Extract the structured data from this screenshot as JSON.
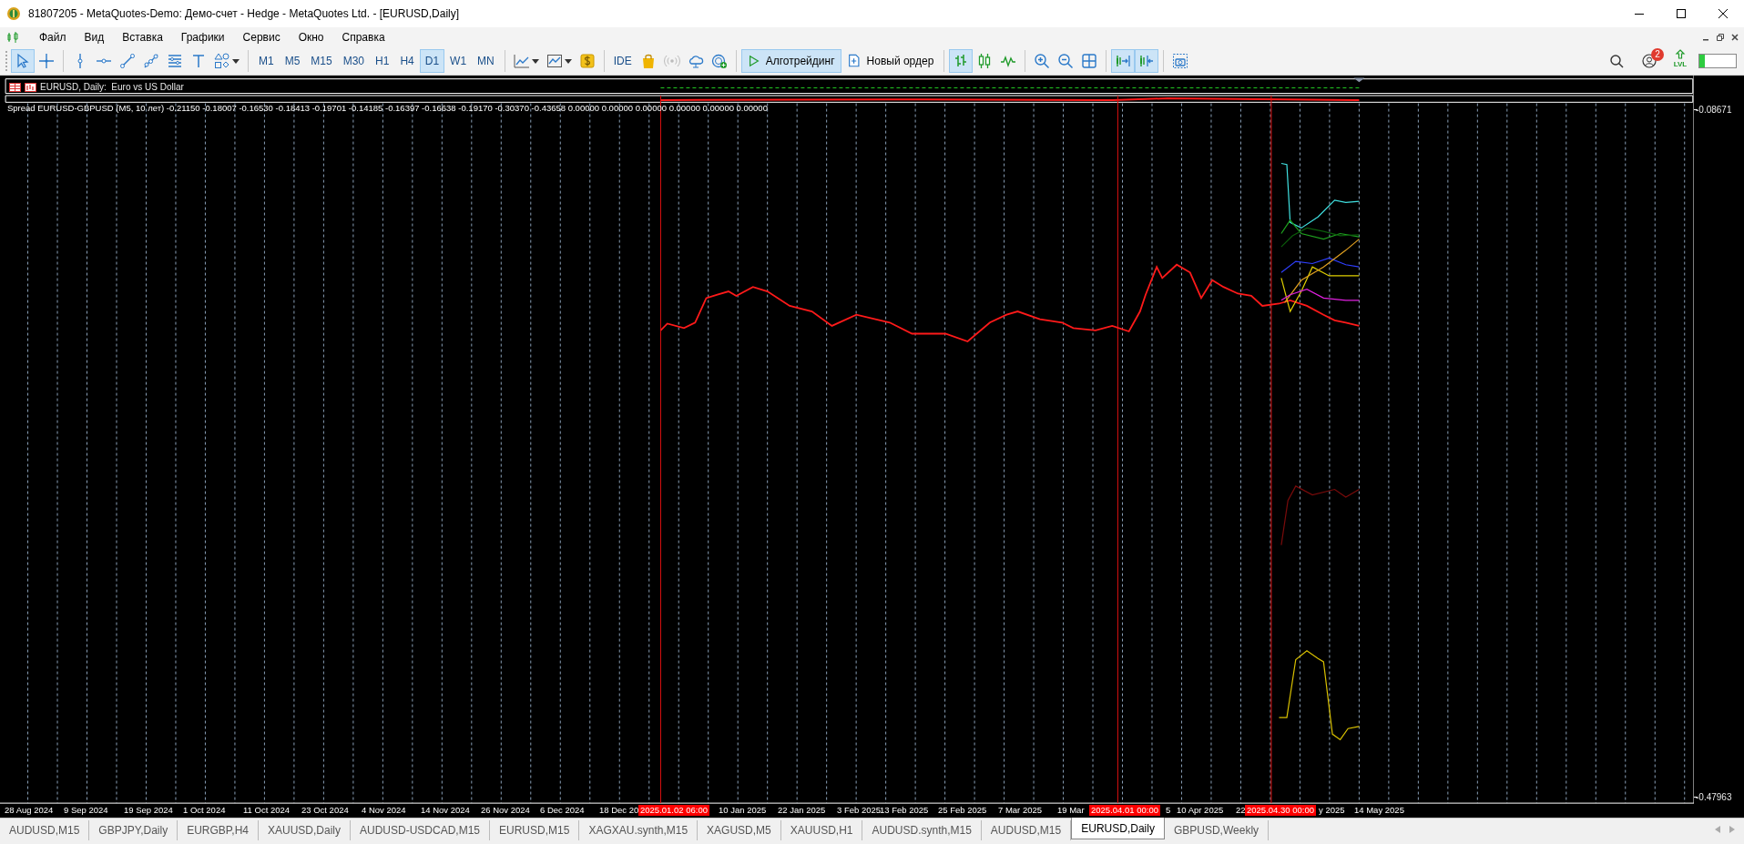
{
  "window": {
    "title": "81807205 - MetaQuotes-Demo: Демо-счет - Hedge - MetaQuotes Ltd. - [EURUSD,Daily]"
  },
  "menu": [
    "Файл",
    "Вид",
    "Вставка",
    "Графики",
    "Сервис",
    "Окно",
    "Справка"
  ],
  "toolbar": {
    "tools": [
      {
        "selected": true
      },
      {
        "selected": false
      },
      {
        "selected": false
      },
      {
        "selected": false
      },
      {
        "selected": false
      },
      {
        "selected": false
      },
      {
        "selected": false
      },
      {
        "selected": false
      },
      {
        "selected": false
      }
    ],
    "timeframes": [
      {
        "label": "M1",
        "selected": false
      },
      {
        "label": "M5",
        "selected": false
      },
      {
        "label": "M15",
        "selected": false
      },
      {
        "label": "M30",
        "selected": false
      },
      {
        "label": "H1",
        "selected": false
      },
      {
        "label": "H4",
        "selected": false
      },
      {
        "label": "D1",
        "selected": true
      },
      {
        "label": "W1",
        "selected": false
      },
      {
        "label": "MN",
        "selected": false
      }
    ],
    "ide_button": "IDE",
    "algo_button": {
      "label": "Алготрейдинг",
      "selected": true
    },
    "order_button": "Новый ордер",
    "chart_types": [
      {
        "selected": true
      },
      {
        "selected": false
      },
      {
        "selected": false
      }
    ],
    "scroll_buttons": [
      {
        "selected": true
      },
      {
        "selected": true
      }
    ],
    "notification_count": "2",
    "level_icon_label": "LVL"
  },
  "chart": {
    "header": "EURUSD, Daily:  Euro vs US Dollar",
    "indicator": "Spread EURUSD-GBPUSD (M5, 10 лет) -0.21150 -0.18007 -0.16530 -0.18413 -0.19701 -0.14185 -0.16397 -0.16638 -0.19170 -0.30370 -0.43658 0.00000 0.00000 0.00000 0.00000 0.00000 0.00000",
    "price_labels": [
      "-0.08671",
      "-0.47963"
    ],
    "date_labels": [
      {
        "text": "28 Aug 2024",
        "kind": "date"
      },
      {
        "text": "9 Sep 2024",
        "kind": "date"
      },
      {
        "text": "19 Sep 2024",
        "kind": "date"
      },
      {
        "text": "1 Oct 2024",
        "kind": "date"
      },
      {
        "text": "11 Oct 2024",
        "kind": "date"
      },
      {
        "text": "23 Oct 2024",
        "kind": "date"
      },
      {
        "text": "4 Nov 2024",
        "kind": "date"
      },
      {
        "text": "14 Nov 2024",
        "kind": "date"
      },
      {
        "text": "26 Nov 2024",
        "kind": "date"
      },
      {
        "text": "6 Dec 2024",
        "kind": "date"
      },
      {
        "text": "18 Dec 20",
        "kind": "date"
      },
      {
        "text": "2025.01.02 06:00",
        "kind": "marker"
      },
      {
        "text": "10 Jan 2025",
        "kind": "date"
      },
      {
        "text": "22 Jan 2025",
        "kind": "date"
      },
      {
        "text": "3 Feb 2025",
        "kind": "date"
      },
      {
        "text": "13 Feb 2025",
        "kind": "date"
      },
      {
        "text": "25 Feb 2025",
        "kind": "date"
      },
      {
        "text": "7 Mar 2025",
        "kind": "date"
      },
      {
        "text": "19 Mar",
        "kind": "date"
      },
      {
        "text": "2025.04.01 00:00",
        "kind": "marker"
      },
      {
        "text": "5",
        "kind": "date"
      },
      {
        "text": "10 Apr 2025",
        "kind": "date"
      },
      {
        "text": "22",
        "kind": "date"
      },
      {
        "text": "2025.04.30 00:00",
        "kind": "marker"
      },
      {
        "text": "y 2025",
        "kind": "date"
      },
      {
        "text": "14 May 2025",
        "kind": "date"
      }
    ]
  },
  "tabs": [
    {
      "label": "AUDUSD,M15",
      "selected": false
    },
    {
      "label": "GBPJPY,Daily",
      "selected": false
    },
    {
      "label": "EURGBP,H4",
      "selected": false
    },
    {
      "label": "XAUUSD,Daily",
      "selected": false
    },
    {
      "label": "AUDUSD-USDCAD,M15",
      "selected": false
    },
    {
      "label": "EURUSD,M15",
      "selected": false
    },
    {
      "label": "XAGXAU.synth,M15",
      "selected": false
    },
    {
      "label": "XAGUSD,M5",
      "selected": false
    },
    {
      "label": "XAUUSD,H1",
      "selected": false
    },
    {
      "label": "AUDUSD.synth,M15",
      "selected": false
    },
    {
      "label": "AUDUSD,M15",
      "selected": false
    },
    {
      "label": "EURUSD,Daily",
      "selected": true
    },
    {
      "label": "GBPUSD,Weekly",
      "selected": false
    }
  ]
}
